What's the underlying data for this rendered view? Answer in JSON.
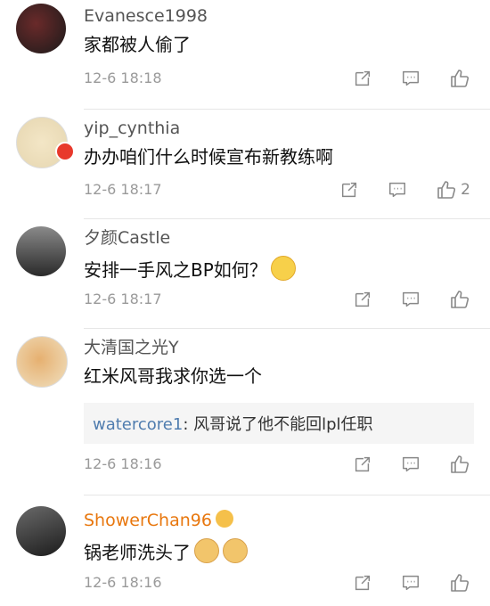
{
  "comments": [
    {
      "user": "Evanesce1998",
      "text": "家都被人偷了",
      "time": "12-6 18:18",
      "likes": ""
    },
    {
      "user": "yip_cynthia",
      "text": "办办咱们什么时候宣布新教练啊",
      "time": "12-6 18:17",
      "likes": "2"
    },
    {
      "user": "夕颜Castle",
      "text": "安排一手风之BP如何？",
      "time": "12-6 18:17",
      "likes": ""
    },
    {
      "user": "大清国之光Y",
      "text": "红米风哥我求你选一个",
      "time": "12-6 18:16",
      "likes": "",
      "reply": {
        "user": "watercore1",
        "text": ": 风哥说了他不能回lpl任职"
      }
    },
    {
      "user": "ShowerChan96",
      "text": "锅老师洗头了",
      "time": "12-6 18:16",
      "likes": ""
    }
  ],
  "icons": {
    "share": "share-icon",
    "comment": "comment-icon",
    "like": "thumbs-up-icon"
  },
  "colors": {
    "username": "#555555",
    "highlight_username": "#e8770e",
    "reply_username": "#507daf"
  }
}
